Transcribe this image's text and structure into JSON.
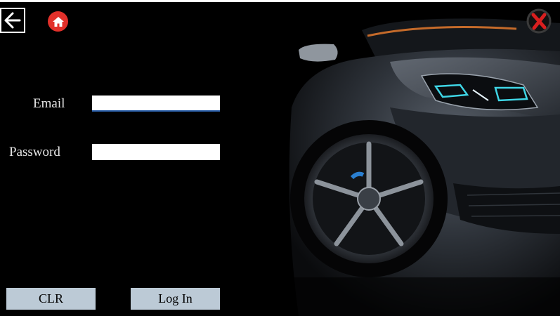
{
  "header": {
    "back_icon": "back-arrow-icon",
    "home_icon": "home-icon",
    "close_icon": "close-icon"
  },
  "form": {
    "email_label": "Email",
    "email_value": "",
    "password_label": "Password",
    "password_value": ""
  },
  "buttons": {
    "clear_label": "CLR",
    "login_label": "Log In"
  },
  "colors": {
    "background": "#000000",
    "button_bg": "#bccad6",
    "home_red": "#e2302a",
    "close_red": "#d81f1f",
    "focus_blue": "#2a5ea8",
    "headlight_cyan": "#3fd6e6"
  }
}
